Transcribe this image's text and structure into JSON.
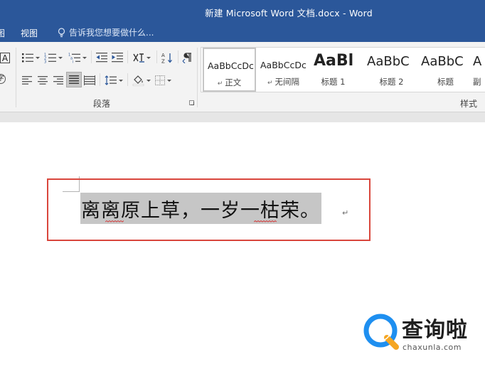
{
  "window": {
    "title": "新建 Microsoft Word 文档.docx - Word"
  },
  "menu": {
    "items": [
      "图",
      "视图"
    ],
    "tell_me": "告诉我您想要做什么..."
  },
  "ribbon": {
    "groups": {
      "paragraph": "段落",
      "styles": "样式"
    },
    "style_gallery": [
      {
        "preview": "AaBbCcDc",
        "name": "正文",
        "selected": true
      },
      {
        "preview": "AaBbCcDc",
        "name": "无间隔"
      },
      {
        "preview": "AaBl",
        "name": "标题 1"
      },
      {
        "preview": "AaBbC",
        "name": "标题 2"
      },
      {
        "preview": "AaBbC",
        "name": "标题"
      },
      {
        "preview": "A",
        "name": "副"
      }
    ]
  },
  "document": {
    "text": "离离原上草，一岁一枯荣。",
    "paragraph_mark": "↵"
  },
  "watermark": {
    "brand": "查询啦",
    "url": "chaxunla.com"
  },
  "colors": {
    "title_bar": "#2b579a",
    "highlight_border": "#d9463c",
    "selection": "#c6c6c6",
    "watermark_blue": "#1e8ff0"
  }
}
